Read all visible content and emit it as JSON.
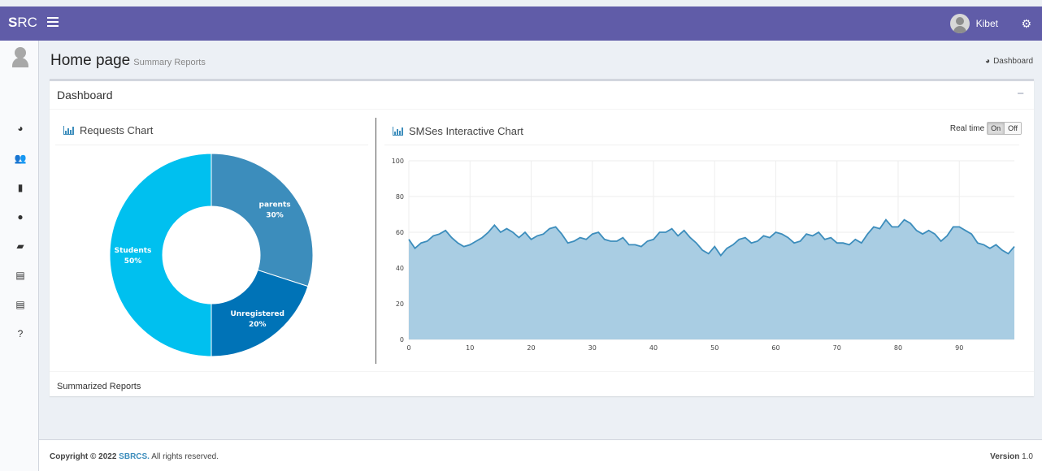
{
  "header": {
    "logo_bold": "S",
    "logo_rest": "RC",
    "user_name": "Kibet",
    "color": "#605ca8"
  },
  "sidebar": {
    "icons": [
      "user-avatar",
      "dashboard-icon",
      "users-icon",
      "file-icon",
      "user-icon",
      "comments-icon",
      "file-text-icon",
      "file-text-icon",
      "question-icon"
    ]
  },
  "page": {
    "title": "Home page",
    "subtitle": "Summary Reports",
    "breadcrumb": "Dashboard"
  },
  "box": {
    "title": "Dashboard",
    "collapse_label": "−",
    "summary_label": "Summarized Reports"
  },
  "charts": {
    "donut_title": "Requests Chart",
    "line_title": "SMSes Interactive Chart",
    "realtime_label": "Real time",
    "toggle_on": "On",
    "toggle_off": "Off"
  },
  "footer": {
    "copyright_prefix": "Copyright © 2022 ",
    "brand": "SBRCS.",
    "copyright_suffix": " All rights reserved.",
    "version_label": "Version",
    "version_value": " 1.0"
  },
  "chart_data": [
    {
      "type": "pie",
      "title": "Requests Chart",
      "donut": true,
      "slices": [
        {
          "label": "parents",
          "value": 30,
          "display": "30%",
          "color": "#3c8dbc"
        },
        {
          "label": "Unregistered",
          "value": 20,
          "display": "20%",
          "color": "#0073b7"
        },
        {
          "label": "Students",
          "value": 50,
          "display": "50%",
          "color": "#00c0ef"
        }
      ]
    },
    {
      "type": "area",
      "title": "SMSes Interactive Chart",
      "xlim": [
        0,
        99
      ],
      "ylim": [
        0,
        100
      ],
      "xticks": [
        0,
        10,
        20,
        30,
        40,
        50,
        60,
        70,
        80,
        90
      ],
      "yticks": [
        0,
        20,
        40,
        60,
        80,
        100
      ],
      "grid": true,
      "line_color": "#3c8dbc",
      "fill_color": "#a9cde3",
      "x": [
        0,
        1,
        2,
        3,
        4,
        5,
        6,
        7,
        8,
        9,
        10,
        11,
        12,
        13,
        14,
        15,
        16,
        17,
        18,
        19,
        20,
        21,
        22,
        23,
        24,
        25,
        26,
        27,
        28,
        29,
        30,
        31,
        32,
        33,
        34,
        35,
        36,
        37,
        38,
        39,
        40,
        41,
        42,
        43,
        44,
        45,
        46,
        47,
        48,
        49,
        50,
        51,
        52,
        53,
        54,
        55,
        56,
        57,
        58,
        59,
        60,
        61,
        62,
        63,
        64,
        65,
        66,
        67,
        68,
        69,
        70,
        71,
        72,
        73,
        74,
        75,
        76,
        77,
        78,
        79,
        80,
        81,
        82,
        83,
        84,
        85,
        86,
        87,
        88,
        89,
        90,
        91,
        92,
        93,
        94,
        95,
        96,
        97,
        98,
        99
      ],
      "y": [
        56,
        51,
        54,
        55,
        58,
        59,
        61,
        57,
        54,
        52,
        53,
        55,
        57,
        60,
        64,
        60,
        62,
        60,
        57,
        60,
        56,
        58,
        59,
        62,
        63,
        59,
        54,
        55,
        57,
        56,
        59,
        60,
        56,
        55,
        55,
        57,
        53,
        53,
        52,
        55,
        56,
        60,
        60,
        62,
        58,
        61,
        57,
        54,
        50,
        48,
        52,
        47,
        51,
        53,
        56,
        57,
        54,
        55,
        58,
        57,
        60,
        59,
        57,
        54,
        55,
        59,
        58,
        60,
        56,
        57,
        54,
        54,
        53,
        56,
        54,
        59,
        63,
        62,
        67,
        63,
        63,
        67,
        65,
        61,
        59,
        61,
        59,
        55,
        58,
        63,
        63,
        61,
        59,
        54,
        53,
        51,
        53,
        50,
        48,
        52
      ]
    }
  ]
}
